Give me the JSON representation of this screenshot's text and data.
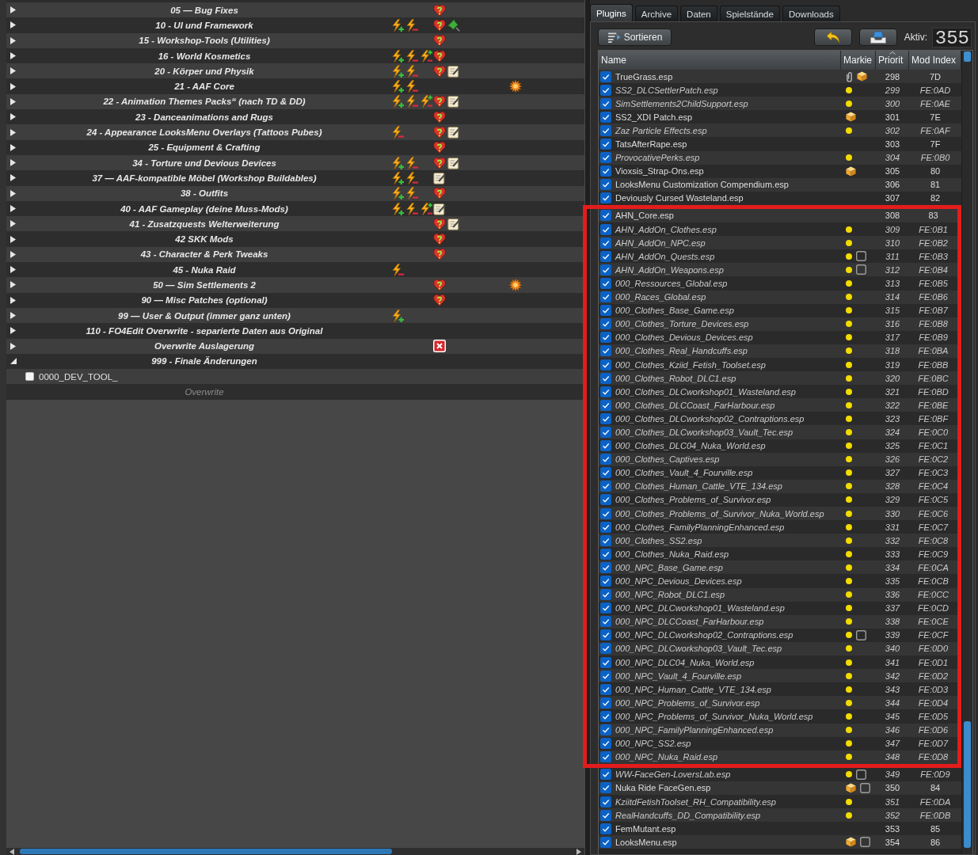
{
  "mod_list": {
    "rows": [
      {
        "kind": "separator",
        "name": "05 — Bug Fixes",
        "expanded": false,
        "flags": [
          {
            "kind": "heart"
          }
        ]
      },
      {
        "kind": "separator",
        "name": "10 - UI und Framework",
        "expanded": false,
        "conflicts": [
          {
            "kind": "plus"
          },
          {
            "kind": "minus"
          }
        ],
        "flags": [
          {
            "kind": "heart"
          },
          {
            "kind": "pin"
          }
        ]
      },
      {
        "kind": "separator",
        "name": "15 - Workshop-Tools (Utilities)",
        "expanded": false,
        "flags": [
          {
            "kind": "heart"
          }
        ]
      },
      {
        "kind": "separator",
        "name": "16 - World Kosmetics",
        "expanded": false,
        "conflicts": [
          {
            "kind": "plus"
          },
          {
            "kind": "minus"
          },
          {
            "kind": "mixed"
          }
        ],
        "flags": [
          {
            "kind": "heart"
          }
        ]
      },
      {
        "kind": "separator",
        "name": "20 - Körper und Physik",
        "expanded": false,
        "conflicts": [
          {
            "kind": "plus"
          },
          {
            "kind": "minus"
          }
        ],
        "flags": [
          {
            "kind": "heart"
          },
          {
            "kind": "note"
          }
        ]
      },
      {
        "kind": "separator",
        "name": "21 - AAF Core",
        "expanded": false,
        "conflicts": [
          {
            "kind": "plus"
          },
          {
            "kind": "minus"
          }
        ],
        "content": [
          {
            "kind": "burst"
          }
        ]
      },
      {
        "kind": "separator",
        "name": "22 - Animation Themes Packs“ (nach TD & DD)",
        "expanded": false,
        "conflicts": [
          {
            "kind": "plus"
          },
          {
            "kind": "minus"
          },
          {
            "kind": "mixed"
          }
        ],
        "flags": [
          {
            "kind": "heart"
          },
          {
            "kind": "note"
          }
        ]
      },
      {
        "kind": "separator",
        "name": "23 - Danceanimations and Rugs",
        "expanded": false,
        "flags": [
          {
            "kind": "heart"
          }
        ]
      },
      {
        "kind": "separator",
        "name": "24 - Appearance LooksMenu Overlays (Tattoos Pubes)",
        "expanded": false,
        "conflicts": [
          {
            "kind": "minus"
          }
        ],
        "flags": [
          {
            "kind": "heart"
          },
          {
            "kind": "note"
          }
        ]
      },
      {
        "kind": "separator",
        "name": "25 - Equipment & Crafting",
        "expanded": false,
        "flags": [
          {
            "kind": "heart"
          }
        ]
      },
      {
        "kind": "separator",
        "name": "34 - Torture und Devious Devices",
        "expanded": false,
        "conflicts": [
          {
            "kind": "plus"
          },
          {
            "kind": "minus"
          }
        ],
        "flags": [
          {
            "kind": "heart"
          },
          {
            "kind": "note"
          }
        ]
      },
      {
        "kind": "separator",
        "name": "37 — AAF-kompatible Möbel (Workshop Buildables)",
        "expanded": false,
        "conflicts": [
          {
            "kind": "plus"
          },
          {
            "kind": "minus"
          }
        ],
        "flags": [
          {
            "kind": "note"
          }
        ]
      },
      {
        "kind": "separator",
        "name": "38 - Outfits",
        "expanded": false,
        "conflicts": [
          {
            "kind": "plus"
          },
          {
            "kind": "minus"
          }
        ],
        "flags": [
          {
            "kind": "heart"
          }
        ]
      },
      {
        "kind": "separator",
        "name": "40 - AAF Gameplay (deine Muss-Mods)",
        "expanded": false,
        "conflicts": [
          {
            "kind": "plus"
          },
          {
            "kind": "minus"
          },
          {
            "kind": "mixed"
          }
        ],
        "flags": [
          {
            "kind": "note"
          }
        ]
      },
      {
        "kind": "separator",
        "name": "41 - Zusatzquests Welterweiterung",
        "expanded": false,
        "flags": [
          {
            "kind": "heart"
          },
          {
            "kind": "note"
          }
        ]
      },
      {
        "kind": "separator",
        "name": "42 SKK Mods",
        "expanded": false,
        "flags": [
          {
            "kind": "heart"
          }
        ]
      },
      {
        "kind": "separator",
        "name": "43 - Character & Perk Tweaks",
        "expanded": false,
        "flags": [
          {
            "kind": "heart"
          }
        ]
      },
      {
        "kind": "separator",
        "name": "45 - Nuka Raid",
        "expanded": false,
        "conflicts": [
          {
            "kind": "minus"
          }
        ]
      },
      {
        "kind": "separator",
        "name": "50 — Sim Settlements 2",
        "expanded": false,
        "flags": [
          {
            "kind": "heart"
          }
        ],
        "content": [
          {
            "kind": "burst"
          }
        ]
      },
      {
        "kind": "separator",
        "name": "90 — Misc Patches (optional)",
        "expanded": false,
        "flags": [
          {
            "kind": "heart"
          }
        ]
      },
      {
        "kind": "separator",
        "name": "99 — User & Output (immer ganz unten)",
        "expanded": false,
        "conflicts": [
          {
            "kind": "plus"
          }
        ]
      },
      {
        "kind": "separator",
        "name": "110 - FO4Edit Overwrite - separierte Daten aus Original",
        "expanded": false
      },
      {
        "kind": "separator",
        "name": "Overwrite Auslagerung",
        "expanded": false,
        "flags": [
          {
            "kind": "cross"
          }
        ]
      },
      {
        "kind": "separator",
        "name": "999 - Finale Änderungen",
        "expanded": true,
        "children": [
          {
            "kind": "mod",
            "name": "0000_DEV_TOOL_",
            "checked": false
          }
        ]
      },
      {
        "kind": "overwrite",
        "name": "Overwrite"
      }
    ]
  },
  "tabs": [
    {
      "label": "Plugins",
      "selected": true
    },
    {
      "label": "Archive",
      "selected": false
    },
    {
      "label": "Daten",
      "selected": false
    },
    {
      "label": "Spielstände",
      "selected": false
    },
    {
      "label": "Downloads",
      "selected": false
    }
  ],
  "toolbar": {
    "sort_button": "Sortieren",
    "active_label": "Aktiv:",
    "active_count": "355"
  },
  "plugin_table": {
    "columns": [
      {
        "label": "Name",
        "sorted": false
      },
      {
        "label": "Markie",
        "sorted": false
      },
      {
        "label": "Priorit",
        "sorted": true
      },
      {
        "label": "Mod Index",
        "sorted": false
      }
    ],
    "rows": [
      {
        "kind": "plugin",
        "name": "TrueGrass.esp",
        "checked": true,
        "light": false,
        "markers": [
          {
            "kind": "clip"
          },
          {
            "kind": "archive"
          }
        ],
        "priority": "298",
        "mod_index": "7D"
      },
      {
        "kind": "plugin",
        "name": "SS2_DLCSettlerPatch.esp",
        "checked": true,
        "light": true,
        "priority": "299",
        "mod_index": "FE:0AD"
      },
      {
        "kind": "plugin",
        "name": "SimSettlements2ChildSupport.esp",
        "checked": true,
        "light": true,
        "priority": "300",
        "mod_index": "FE:0AE"
      },
      {
        "kind": "plugin",
        "name": "SS2_XDI Patch.esp",
        "checked": true,
        "light": false,
        "markers": [
          {
            "kind": "archive"
          }
        ],
        "priority": "301",
        "mod_index": "7E"
      },
      {
        "kind": "plugin",
        "name": "Zaz Particle Effects.esp",
        "checked": true,
        "light": true,
        "priority": "302",
        "mod_index": "FE:0AF"
      },
      {
        "kind": "plugin",
        "name": "TatsAfterRape.esp",
        "checked": true,
        "light": false,
        "priority": "303",
        "mod_index": "7F"
      },
      {
        "kind": "plugin",
        "name": "ProvocativePerks.esp",
        "checked": true,
        "light": true,
        "priority": "304",
        "mod_index": "FE:0B0"
      },
      {
        "kind": "plugin",
        "name": "Vioxsis_Strap-Ons.esp",
        "checked": true,
        "light": false,
        "markers": [
          {
            "kind": "archive"
          }
        ],
        "priority": "305",
        "mod_index": "80"
      },
      {
        "kind": "plugin",
        "name": "LooksMenu Customization Compendium.esp",
        "checked": true,
        "light": false,
        "priority": "306",
        "mod_index": "81"
      },
      {
        "kind": "plugin",
        "name": "Deviously Cursed Wasteland.esp",
        "checked": true,
        "light": false,
        "priority": "307",
        "mod_index": "82"
      },
      {
        "kind": "highlight",
        "rows": [
          {
            "kind": "plugin",
            "name": "AHN_Core.esp",
            "checked": true,
            "light": false,
            "priority": "308",
            "mod_index": "83"
          },
          {
            "kind": "plugin",
            "name": "AHN_AddOn_Clothes.esp",
            "checked": true,
            "light": true,
            "priority": "309",
            "mod_index": "FE:0B1"
          },
          {
            "kind": "plugin",
            "name": "AHN_AddOn_NPC.esp",
            "checked": true,
            "light": true,
            "priority": "310",
            "mod_index": "FE:0B2"
          },
          {
            "kind": "plugin",
            "name": "AHN_AddOn_Quests.esp",
            "checked": true,
            "light": true,
            "markers": [
              {
                "kind": "frame"
              }
            ],
            "priority": "311",
            "mod_index": "FE:0B3"
          },
          {
            "kind": "plugin",
            "name": "AHN_AddOn_Weapons.esp",
            "checked": true,
            "light": true,
            "markers": [
              {
                "kind": "frame"
              }
            ],
            "priority": "312",
            "mod_index": "FE:0B4"
          },
          {
            "kind": "plugin",
            "name": "000_Ressources_Global.esp",
            "checked": true,
            "light": true,
            "priority": "313",
            "mod_index": "FE:0B5"
          },
          {
            "kind": "plugin",
            "name": "000_Races_Global.esp",
            "checked": true,
            "light": true,
            "priority": "314",
            "mod_index": "FE:0B6"
          },
          {
            "kind": "plugin",
            "name": "000_Clothes_Base_Game.esp",
            "checked": true,
            "light": true,
            "priority": "315",
            "mod_index": "FE:0B7"
          },
          {
            "kind": "plugin",
            "name": "000_Clothes_Torture_Devices.esp",
            "checked": true,
            "light": true,
            "priority": "316",
            "mod_index": "FE:0B8"
          },
          {
            "kind": "plugin",
            "name": "000_Clothes_Devious_Devices.esp",
            "checked": true,
            "light": true,
            "priority": "317",
            "mod_index": "FE:0B9"
          },
          {
            "kind": "plugin",
            "name": "000_Clothes_Real_Handcuffs.esp",
            "checked": true,
            "light": true,
            "priority": "318",
            "mod_index": "FE:0BA"
          },
          {
            "kind": "plugin",
            "name": "000_Clothes_Kziid_Fetish_Toolset.esp",
            "checked": true,
            "light": true,
            "priority": "319",
            "mod_index": "FE:0BB"
          },
          {
            "kind": "plugin",
            "name": "000_Clothes_Robot_DLC1.esp",
            "checked": true,
            "light": true,
            "priority": "320",
            "mod_index": "FE:0BC"
          },
          {
            "kind": "plugin",
            "name": "000_Clothes_DLCworkshop01_Wasteland.esp",
            "checked": true,
            "light": true,
            "priority": "321",
            "mod_index": "FE:0BD"
          },
          {
            "kind": "plugin",
            "name": "000_Clothes_DLCCoast_FarHarbour.esp",
            "checked": true,
            "light": true,
            "priority": "322",
            "mod_index": "FE:0BE"
          },
          {
            "kind": "plugin",
            "name": "000_Clothes_DLCworkshop02_Contraptions.esp",
            "checked": true,
            "light": true,
            "priority": "323",
            "mod_index": "FE:0BF"
          },
          {
            "kind": "plugin",
            "name": "000_Clothes_DLCworkshop03_Vault_Tec.esp",
            "checked": true,
            "light": true,
            "priority": "324",
            "mod_index": "FE:0C0"
          },
          {
            "kind": "plugin",
            "name": "000_Clothes_DLC04_Nuka_World.esp",
            "checked": true,
            "light": true,
            "priority": "325",
            "mod_index": "FE:0C1"
          },
          {
            "kind": "plugin",
            "name": "000_Clothes_Captives.esp",
            "checked": true,
            "light": true,
            "priority": "326",
            "mod_index": "FE:0C2"
          },
          {
            "kind": "plugin",
            "name": "000_Clothes_Vault_4_Fourville.esp",
            "checked": true,
            "light": true,
            "priority": "327",
            "mod_index": "FE:0C3"
          },
          {
            "kind": "plugin",
            "name": "000_Clothes_Human_Cattle_VTE_134.esp",
            "checked": true,
            "light": true,
            "priority": "328",
            "mod_index": "FE:0C4"
          },
          {
            "kind": "plugin",
            "name": "000_Clothes_Problems_of_Survivor.esp",
            "checked": true,
            "light": true,
            "priority": "329",
            "mod_index": "FE:0C5"
          },
          {
            "kind": "plugin",
            "name": "000_Clothes_Problems_of_Survivor_Nuka_World.esp",
            "checked": true,
            "light": true,
            "priority": "330",
            "mod_index": "FE:0C6"
          },
          {
            "kind": "plugin",
            "name": "000_Clothes_FamilyPlanningEnhanced.esp",
            "checked": true,
            "light": true,
            "priority": "331",
            "mod_index": "FE:0C7"
          },
          {
            "kind": "plugin",
            "name": "000_Clothes_SS2.esp",
            "checked": true,
            "light": true,
            "priority": "332",
            "mod_index": "FE:0C8"
          },
          {
            "kind": "plugin",
            "name": "000_Clothes_Nuka_Raid.esp",
            "checked": true,
            "light": true,
            "priority": "333",
            "mod_index": "FE:0C9"
          },
          {
            "kind": "plugin",
            "name": "000_NPC_Base_Game.esp",
            "checked": true,
            "light": true,
            "priority": "334",
            "mod_index": "FE:0CA"
          },
          {
            "kind": "plugin",
            "name": "000_NPC_Devious_Devices.esp",
            "checked": true,
            "light": true,
            "priority": "335",
            "mod_index": "FE:0CB"
          },
          {
            "kind": "plugin",
            "name": "000_NPC_Robot_DLC1.esp",
            "checked": true,
            "light": true,
            "priority": "336",
            "mod_index": "FE:0CC"
          },
          {
            "kind": "plugin",
            "name": "000_NPC_DLCworkshop01_Wasteland.esp",
            "checked": true,
            "light": true,
            "priority": "337",
            "mod_index": "FE:0CD"
          },
          {
            "kind": "plugin",
            "name": "000_NPC_DLCCoast_FarHarbour.esp",
            "checked": true,
            "light": true,
            "priority": "338",
            "mod_index": "FE:0CE"
          },
          {
            "kind": "plugin",
            "name": "000_NPC_DLCworkshop02_Contraptions.esp",
            "checked": true,
            "light": true,
            "markers": [
              {
                "kind": "frame"
              }
            ],
            "priority": "339",
            "mod_index": "FE:0CF"
          },
          {
            "kind": "plugin",
            "name": "000_NPC_DLCworkshop03_Vault_Tec.esp",
            "checked": true,
            "light": true,
            "priority": "340",
            "mod_index": "FE:0D0"
          },
          {
            "kind": "plugin",
            "name": "000_NPC_DLC04_Nuka_World.esp",
            "checked": true,
            "light": true,
            "priority": "341",
            "mod_index": "FE:0D1"
          },
          {
            "kind": "plugin",
            "name": "000_NPC_Vault_4_Fourville.esp",
            "checked": true,
            "light": true,
            "priority": "342",
            "mod_index": "FE:0D2"
          },
          {
            "kind": "plugin",
            "name": "000_NPC_Human_Cattle_VTE_134.esp",
            "checked": true,
            "light": true,
            "priority": "343",
            "mod_index": "FE:0D3"
          },
          {
            "kind": "plugin",
            "name": "000_NPC_Problems_of_Survivor.esp",
            "checked": true,
            "light": true,
            "priority": "344",
            "mod_index": "FE:0D4"
          },
          {
            "kind": "plugin",
            "name": "000_NPC_Problems_of_Survivor_Nuka_World.esp",
            "checked": true,
            "light": true,
            "priority": "345",
            "mod_index": "FE:0D5"
          },
          {
            "kind": "plugin",
            "name": "000_NPC_FamilyPlanningEnhanced.esp",
            "checked": true,
            "light": true,
            "priority": "346",
            "mod_index": "FE:0D6"
          },
          {
            "kind": "plugin",
            "name": "000_NPC_SS2.esp",
            "checked": true,
            "light": true,
            "priority": "347",
            "mod_index": "FE:0D7"
          },
          {
            "kind": "plugin",
            "name": "000_NPC_Nuka_Raid.esp",
            "checked": true,
            "light": true,
            "priority": "348",
            "mod_index": "FE:0D8"
          }
        ]
      },
      {
        "kind": "plugin",
        "name": "WW-FaceGen-LoversLab.esp",
        "checked": true,
        "light": true,
        "markers": [
          {
            "kind": "frame"
          }
        ],
        "priority": "349",
        "mod_index": "FE:0D9"
      },
      {
        "kind": "plugin",
        "name": "Nuka Ride FaceGen.esp",
        "checked": true,
        "light": false,
        "markers": [
          {
            "kind": "archive"
          },
          {
            "kind": "frame"
          }
        ],
        "priority": "350",
        "mod_index": "84"
      },
      {
        "kind": "plugin",
        "name": "KziitdFetishToolset_RH_Compatibility.esp",
        "checked": true,
        "light": true,
        "priority": "351",
        "mod_index": "FE:0DA"
      },
      {
        "kind": "plugin",
        "name": "RealHandcuffs_DD_Compatibility.esp",
        "checked": true,
        "light": true,
        "priority": "352",
        "mod_index": "FE:0DB"
      },
      {
        "kind": "plugin",
        "name": "FemMutant.esp",
        "checked": true,
        "light": false,
        "priority": "353",
        "mod_index": "85"
      },
      {
        "kind": "plugin",
        "name": "LooksMenu.esp",
        "checked": true,
        "light": false,
        "markers": [
          {
            "kind": "archive"
          },
          {
            "kind": "frame"
          }
        ],
        "priority": "354",
        "mod_index": "86"
      }
    ]
  }
}
